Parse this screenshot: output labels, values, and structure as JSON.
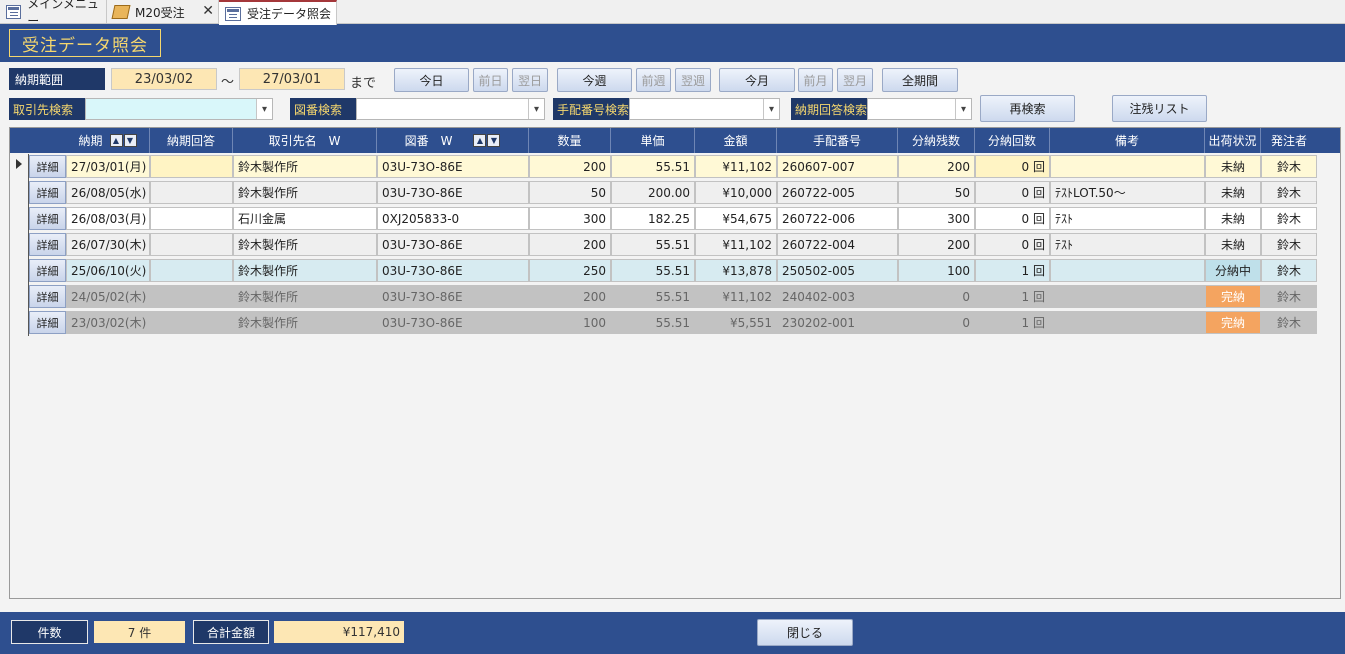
{
  "tabs": [
    {
      "label": "メインメニュー"
    },
    {
      "label": "M20受注"
    },
    {
      "label": "受注データ照会"
    }
  ],
  "form_title": "受注データ照会",
  "filters": {
    "date_range_label": "納期範囲",
    "date_from": "23/03/02",
    "tilde": "～",
    "date_to": "27/03/01",
    "until": "まで",
    "buttons": {
      "today": "今日",
      "prev_day": "前日",
      "next_day": "翌日",
      "this_week": "今週",
      "prev_week": "前週",
      "next_week": "翌週",
      "this_month": "今月",
      "prev_month": "前月",
      "next_month": "翌月",
      "all_period": "全期間"
    },
    "client_search_label": "取引先検索",
    "client_search_value": "",
    "drawing_search_label": "図番検索",
    "drawing_search_value": "",
    "order_no_search_label": "手配番号検索",
    "order_no_search_value": "",
    "due_reply_search_label": "納期回答検索",
    "due_reply_search_value": "",
    "research_button": "再検索",
    "backorder_list_button": "注残リスト"
  },
  "grid": {
    "headers": {
      "due": "納期",
      "due_reply": "納期回答",
      "client": "取引先名　W",
      "drawing": "図番　W",
      "qty": "数量",
      "unit_price": "単価",
      "amount": "金額",
      "order_no": "手配番号",
      "remaining": "分納残数",
      "deliveries": "分納回数",
      "note": "備考",
      "ship_status": "出荷状況",
      "orderer": "発注者"
    },
    "detail_label": "詳細",
    "rows": [
      {
        "due": "27/03/01(月)",
        "due_reply": "",
        "client": "鈴木製作所",
        "drawing": "03U-73O-86E",
        "qty": "200",
        "unit_price": "55.51",
        "amount": "¥11,102",
        "order_no": "260607-007",
        "remaining": "200",
        "deliveries": "0 回",
        "note": "",
        "ship_status": "未納",
        "orderer": "鈴木"
      },
      {
        "due": "26/08/05(水)",
        "due_reply": "",
        "client": "鈴木製作所",
        "drawing": "03U-73O-86E",
        "qty": "50",
        "unit_price": "200.00",
        "amount": "¥10,000",
        "order_no": "260722-005",
        "remaining": "50",
        "deliveries": "0 回",
        "note": "ﾃｽﾄLOT.50～",
        "ship_status": "未納",
        "orderer": "鈴木"
      },
      {
        "due": "26/08/03(月)",
        "due_reply": "",
        "client": "石川金属",
        "drawing": "0XJ205833-0",
        "qty": "300",
        "unit_price": "182.25",
        "amount": "¥54,675",
        "order_no": "260722-006",
        "remaining": "300",
        "deliveries": "0 回",
        "note": "ﾃｽﾄ",
        "ship_status": "未納",
        "orderer": "鈴木"
      },
      {
        "due": "26/07/30(木)",
        "due_reply": "",
        "client": "鈴木製作所",
        "drawing": "03U-73O-86E",
        "qty": "200",
        "unit_price": "55.51",
        "amount": "¥11,102",
        "order_no": "260722-004",
        "remaining": "200",
        "deliveries": "0 回",
        "note": "ﾃｽﾄ",
        "ship_status": "未納",
        "orderer": "鈴木"
      },
      {
        "due": "25/06/10(火)",
        "due_reply": "",
        "client": "鈴木製作所",
        "drawing": "03U-73O-86E",
        "qty": "250",
        "unit_price": "55.51",
        "amount": "¥13,878",
        "order_no": "250502-005",
        "remaining": "100",
        "deliveries": "1 回",
        "note": "",
        "ship_status": "分納中",
        "orderer": "鈴木"
      },
      {
        "due": "24/05/02(木)",
        "due_reply": "",
        "client": "鈴木製作所",
        "drawing": "03U-73O-86E",
        "qty": "200",
        "unit_price": "55.51",
        "amount": "¥11,102",
        "order_no": "240402-003",
        "remaining": "0",
        "deliveries": "1 回",
        "note": "",
        "ship_status": "完納",
        "orderer": "鈴木"
      },
      {
        "due": "23/03/02(木)",
        "due_reply": "",
        "client": "鈴木製作所",
        "drawing": "03U-73O-86E",
        "qty": "100",
        "unit_price": "55.51",
        "amount": "¥5,551",
        "order_no": "230202-001",
        "remaining": "0",
        "deliveries": "1 回",
        "note": "",
        "ship_status": "完納",
        "orderer": "鈴木"
      }
    ]
  },
  "footer": {
    "count_label": "件数",
    "count_value": "7 件",
    "total_label": "合計金額",
    "total_value": "¥117,410",
    "close_button": "閉じる"
  },
  "colors": {
    "header_blue": "#2e4f8f",
    "label_navy": "#1f3868",
    "date_fill": "#fde7b4",
    "current_row": "#fff9d6",
    "partial_row": "#d7ebf1",
    "complete_row": "#c2c2c2",
    "complete_status": "#f4a460"
  }
}
